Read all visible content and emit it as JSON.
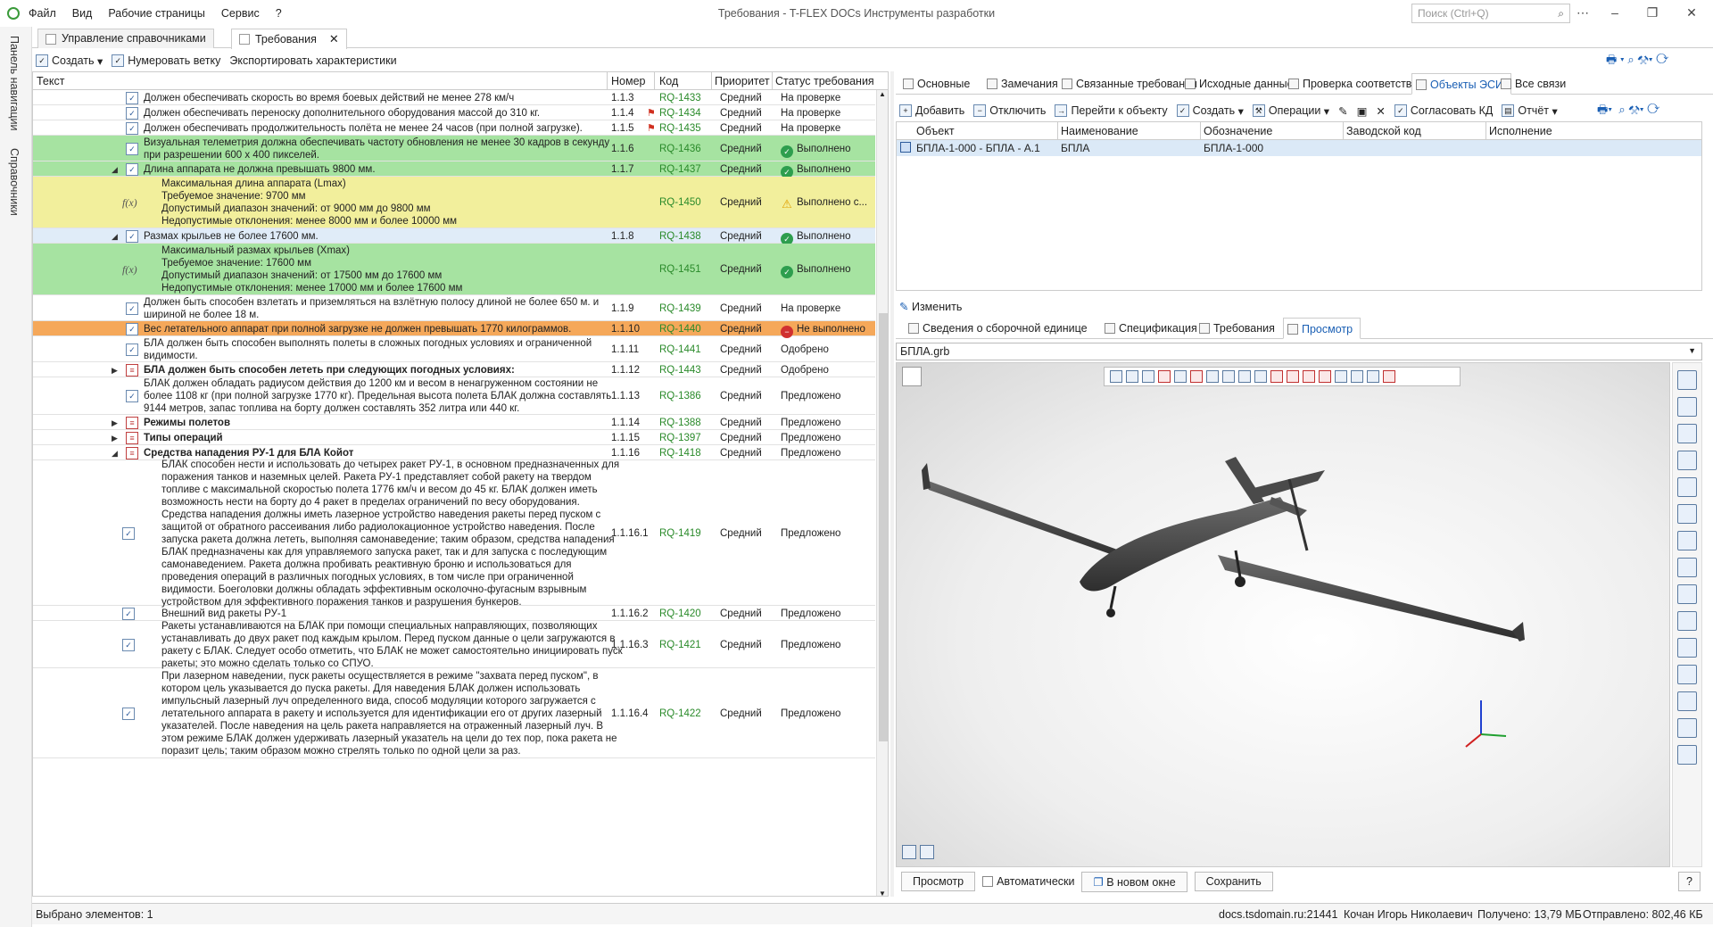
{
  "titlebar": {
    "menu": [
      "Файл",
      "Вид",
      "Рабочие страницы",
      "Сервис",
      "?"
    ],
    "title": "Требования - T-FLEX DOCs Инструменты разработки",
    "search_placeholder": "Поиск (Ctrl+Q)"
  },
  "leftstrip": {
    "nav": "Панель навигации",
    "ref": "Справочники"
  },
  "doctabs": [
    {
      "label": "Управление справочниками"
    },
    {
      "label": "Требования"
    }
  ],
  "lefttool": {
    "create": "Создать",
    "number": "Нумеровать ветку",
    "export": "Экспортировать характеристики"
  },
  "grid": {
    "columns": [
      "Текст",
      "Номер",
      "Код",
      "Приоритет",
      "Статус требования"
    ],
    "rows": [
      {
        "text": "Должен обеспечивать скорость во время боевых действий не менее 278 км/ч",
        "num": "1.1.3",
        "code": "RQ-1433",
        "prio": "Средний",
        "status": "На проверке"
      },
      {
        "text": "Должен обеспечивать переноску дополнительного оборудования массой до 310 кг.",
        "num": "1.1.4",
        "code": "RQ-1434",
        "prio": "Средний",
        "status": "На проверке"
      },
      {
        "text": "Должен обеспечивать продолжительность полёта не менее 24 часов (при полной загрузке).",
        "num": "1.1.5",
        "code": "RQ-1435",
        "prio": "Средний",
        "status": "На проверке"
      },
      {
        "text": "Визуальная телеметрия должна обеспечивать частоту обновления не менее 30 кадров в секунду при разрешении 600 х 400 пикселей.",
        "num": "1.1.6",
        "code": "RQ-1436",
        "prio": "Средний",
        "status": "Выполнено"
      },
      {
        "text": "Длина аппарата не должна превышать 9800 мм.",
        "num": "1.1.7",
        "code": "RQ-1437",
        "prio": "Средний",
        "status": "Выполнено"
      },
      {
        "text": "Максимальная длина аппарата (Lmax)\nТребуемое значение: 9700 мм\nДопустимый диапазон значений: от 9000 мм до  9800 мм\nНедопустимые отклонения: менее 8000 мм и более 10000 мм",
        "num": "",
        "code": "RQ-1450",
        "prio": "Средний",
        "status": "Выполнено с..."
      },
      {
        "text": "Размах крыльев не более 17600 мм.",
        "num": "1.1.8",
        "code": "RQ-1438",
        "prio": "Средний",
        "status": "Выполнено"
      },
      {
        "text": "Максимальный размах крыльев (Xmax)\nТребуемое значение: 17600 мм\nДопустимый диапазон значений: от 17500 мм до  17600 мм\nНедопустимые отклонения: менее 17000 мм и более 17600 мм",
        "num": "",
        "code": "RQ-1451",
        "prio": "Средний",
        "status": "Выполнено"
      },
      {
        "text": "Должен быть способен взлетать и приземляться на взлётную полосу длиной не более 650 м. и шириной не более 18 м.",
        "num": "1.1.9",
        "code": "RQ-1439",
        "prio": "Средний",
        "status": "На проверке"
      },
      {
        "text": "Вес летательного аппарат при полной загрузке не должен превышать 1770 килограммов.",
        "num": "1.1.10",
        "code": "RQ-1440",
        "prio": "Средний",
        "status": "Не выполнено"
      },
      {
        "text": "БЛА должен быть способен выполнять полеты в сложных погодных условиях и ограниченной видимости.",
        "num": "1.1.11",
        "code": "RQ-1441",
        "prio": "Средний",
        "status": "Одобрено"
      },
      {
        "text": "БЛА должен быть способен лететь при следующих погодных условиях:",
        "num": "1.1.12",
        "code": "RQ-1443",
        "prio": "Средний",
        "status": "Одобрено"
      },
      {
        "text": "БЛАК должен обладать радиусом действия до 1200 км и весом в ненагруженном состоянии не более 1108 кг (при полной загрузке 1770 кг). Предельная высота полета БЛАК должна составлять 9144 метров, запас топлива на борту должен составлять 352 литра или 440 кг.",
        "num": "1.1.13",
        "code": "RQ-1386",
        "prio": "Средний",
        "status": "Предложено"
      },
      {
        "text": "Режимы полетов",
        "num": "1.1.14",
        "code": "RQ-1388",
        "prio": "Средний",
        "status": "Предложено"
      },
      {
        "text": "Типы операций",
        "num": "1.1.15",
        "code": "RQ-1397",
        "prio": "Средний",
        "status": "Предложено"
      },
      {
        "text": "Средства нападения РУ-1 для БЛА Койот",
        "num": "1.1.16",
        "code": "RQ-1418",
        "prio": "Средний",
        "status": "Предложено"
      },
      {
        "text": "БЛАК способен нести и использовать до четырех ракет РУ-1, в основном предназначенных для поражения танков и наземных целей. Ракета РУ-1 представляет собой ракету на твердом топливе с максимальной скоростью полета 1776 км/ч и весом до 45 кг. БЛАК должен иметь возможность нести на борту до 4 ракет в пределах ограничений по весу оборудования. Средства нападения должны иметь лазерное устройство наведения ракеты перед пуском с защитой от обратного рассеивания либо радиолокационное устройство наведения. После запуска ракета должна лететь, выполняя самонаведение; таким образом, средства нападения БЛАК предназначены как для управляемого запуска ракет, так и для запуска с последующим самонаведением. Ракета должна пробивать реактивную броню и использоваться для проведения операций в различных погодных условиях, в том числе при ограниченной видимости. Боеголовки должны обладать эффективным осколочно-фугасным взрывным устройством для эффективного поражения танков и разрушения бункеров.",
        "num": "1.1.16.1",
        "code": "RQ-1419",
        "prio": "Средний",
        "status": "Предложено"
      },
      {
        "text": "Внешний вид ракеты РУ-1",
        "num": "1.1.16.2",
        "code": "RQ-1420",
        "prio": "Средний",
        "status": "Предложено"
      },
      {
        "text": "Ракеты устанавливаются на БЛАК при помощи специальных направляющих, позволяющих устанавливать до двух ракет под каждым крылом. Перед пуском данные о цели загружаются в ракету с БЛАК. Следует особо отметить, что БЛАК не может самостоятельно инициировать пуск ракеты; это можно сделать только со СПУО.",
        "num": "1.1.16.3",
        "code": "RQ-1421",
        "prio": "Средний",
        "status": "Предложено"
      },
      {
        "text": "При лазерном наведении, пуск ракеты осуществляется в режиме \"захвата перед пуском\", в котором цель указывается до пуска ракеты. Для наведения БЛАК должен использовать импульсный лазерный луч определенного вида, способ модуляции которого загружается с летательного аппарата в ракету и используется для идентификации его от других лазерный указателей. После наведения на цель ракета направляется на отраженный лазерный луч. В этом режиме БЛАК должен удерживать лазерный указатель на цели до тех пор, пока ракета не поразит цель; таким образом можно стрелять только по одной цели за раз.",
        "num": "1.1.16.4",
        "code": "RQ-1422",
        "prio": "Средний",
        "status": "Предложено"
      }
    ]
  },
  "rtabs": [
    "Основные",
    "Замечания",
    "Связанные требования",
    "Исходные данные",
    "Проверка соответствия",
    "Объекты ЭСИ",
    "Все связи"
  ],
  "rtool": {
    "add": "Добавить",
    "detach": "Отключить",
    "goto": "Перейти к объекту",
    "create": "Создать",
    "ops": "Операции",
    "agree": "Согласовать КД",
    "report": "Отчёт"
  },
  "otable": {
    "columns": [
      "Объект",
      "Наименование",
      "Обозначение",
      "Заводской код",
      "Исполнение"
    ],
    "row": {
      "object": "БПЛА-1-000 - БПЛА - А.1",
      "name": "БПЛА",
      "designation": "БПЛА-1-000",
      "factory": "",
      "exec": ""
    }
  },
  "edit": "Изменить",
  "btabs": [
    "Сведения о сборочной единице",
    "Спецификация",
    "Требования",
    "Просмотр"
  ],
  "file": "БПЛА.grb",
  "vbottom": {
    "preview": "Просмотр",
    "auto": "Автоматически",
    "newwin": "В новом окне",
    "save": "Сохранить",
    "help": "?"
  },
  "status": {
    "selected": "Выбрано элементов: 1",
    "server": "docs.tsdomain.ru:21441",
    "user": "Кочан Игорь Николаевич",
    "recv": "Получено: 13,79 МБ",
    "sent": "Отправлено: 802,46 КБ"
  },
  "colors": {
    "green": "#a6e3a1",
    "yellow": "#f2ef9c",
    "orange": "#f5a85a",
    "selected": "#e0ecf8",
    "accent": "#1a5fb4"
  }
}
